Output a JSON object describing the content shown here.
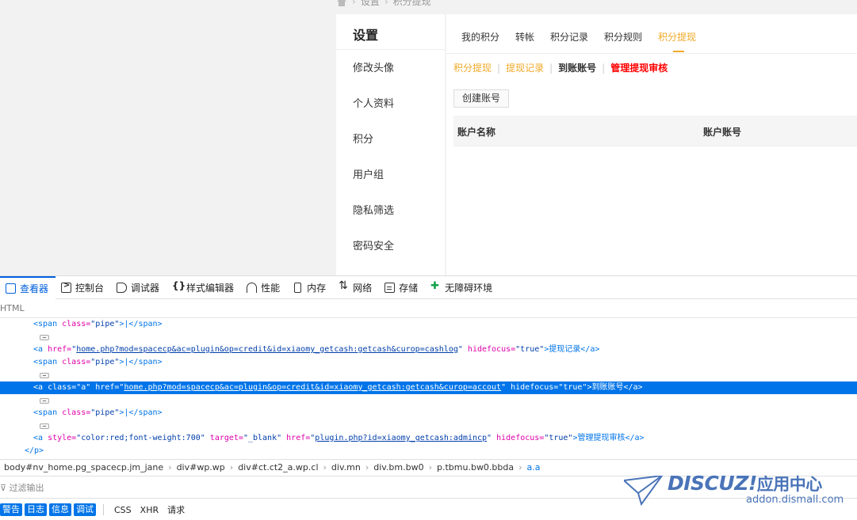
{
  "breadcrumb": {
    "items": [
      "设置",
      "积分提现"
    ]
  },
  "sidebar": {
    "title": "设置",
    "items": [
      "修改头像",
      "个人资料",
      "积分",
      "用户组",
      "隐私筛选",
      "密码安全"
    ]
  },
  "tabs": {
    "items": [
      "我的积分",
      "转帐",
      "积分记录",
      "积分规则",
      "积分提现"
    ],
    "active_index": 4
  },
  "subnav": {
    "link1": "积分提现",
    "link2": "提现记录",
    "current": "到账账号",
    "admin": "管理提现审核",
    "pipe": "|"
  },
  "create_button": "创建账号",
  "table": {
    "headers": [
      "账户名称",
      "账户账号"
    ]
  },
  "devtools": {
    "tabs": [
      "查看器",
      "控制台",
      "调试器",
      "样式编辑器",
      "性能",
      "内存",
      "网络",
      "存储",
      "无障碍环境"
    ],
    "section_label": "HTML",
    "code": {
      "span_open": "<span",
      "class_attr": "class=",
      "pipe_val": "\"pipe\"",
      "span_text": ">|</span>",
      "a_open": "<a",
      "href_attr": "href=",
      "hidefocus_attr": "hidefocus=",
      "hidefocus_val": "\"true\"",
      "cashlog_url": "home.php?mod=spacecp&ac=plugin&op=credit&id=xiaomy_getcash:getcash&curop=cashlog",
      "cashlog_text": ">提现记录</a>",
      "sel_class_val": "\"a\"",
      "accout_url": "home.php?mod=spacecp&ac=plugin&op=credit&id=xiaomy_getcash:getcash&curop=accout",
      "accout_text": ">到账账号</a>",
      "style_attr": "style=",
      "style_val": "\"color:red;font-weight:700\"",
      "target_attr": "target=",
      "target_val": "\"_blank\"",
      "admin_url": "plugin.php?id=xiaomy_getcash:admincp",
      "admin_text": ">管理提现审核</a>",
      "p_close": "</p>",
      "q": "\""
    },
    "crumbs": [
      "body#nv_home.pg_spacecp.jm_jane",
      "div#wp.wp",
      "div#ct.ct2_a.wp.cl",
      "div.mn",
      "div.bm.bw0",
      "p.tbmu.bw0.bbda",
      "a.a"
    ],
    "filter_placeholder": "过滤输出",
    "filter_badges": [
      "警告",
      "日志",
      "信息",
      "调试"
    ],
    "filter_plain": [
      "CSS",
      "XHR",
      "请求"
    ]
  },
  "watermark": {
    "logo": "DISCUZ!",
    "logo_cn": "应用中心",
    "url": "addon.dismall.com"
  },
  "colors": {
    "accent": "#f0a928",
    "selection": "#0074e8",
    "danger": "#ff0000"
  }
}
